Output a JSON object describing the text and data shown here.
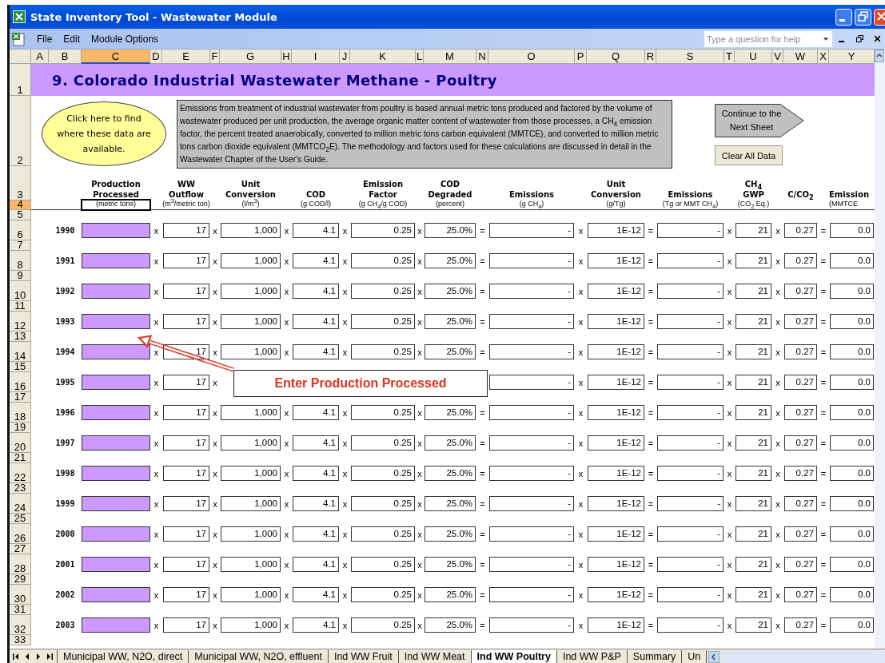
{
  "window": {
    "title": "State Inventory Tool - Wastewater Module"
  },
  "menu": [
    "File",
    "Edit",
    "Module Options"
  ],
  "help_search": {
    "placeholder": "Type a question for help"
  },
  "column_headers": [
    {
      "label": "A",
      "selected": false
    },
    {
      "label": "B",
      "selected": false
    },
    {
      "label": "C",
      "selected": true
    },
    {
      "label": "D",
      "selected": false
    },
    {
      "label": "E",
      "selected": false
    },
    {
      "label": "F",
      "selected": false
    },
    {
      "label": "G",
      "selected": false
    },
    {
      "label": "H",
      "selected": false
    },
    {
      "label": "I",
      "selected": false
    },
    {
      "label": "J",
      "selected": false
    },
    {
      "label": "K",
      "selected": false
    },
    {
      "label": "L",
      "selected": false
    },
    {
      "label": "M",
      "selected": false
    },
    {
      "label": "N",
      "selected": false
    },
    {
      "label": "O",
      "selected": false
    },
    {
      "label": "P",
      "selected": false
    },
    {
      "label": "Q",
      "selected": false
    },
    {
      "label": "R",
      "selected": false
    },
    {
      "label": "S",
      "selected": false
    },
    {
      "label": "T",
      "selected": false
    },
    {
      "label": "U",
      "selected": false
    },
    {
      "label": "V",
      "selected": false
    },
    {
      "label": "W",
      "selected": false
    },
    {
      "label": "X",
      "selected": false
    },
    {
      "label": "Y",
      "selected": false
    }
  ],
  "row_numbers": [
    {
      "label": "1",
      "selected": false
    },
    {
      "label": "2",
      "selected": false
    },
    {
      "label": "3",
      "selected": false
    },
    {
      "label": "4",
      "selected": true
    },
    {
      "label": "5",
      "selected": false
    },
    {
      "label": "6",
      "selected": false
    },
    {
      "label": "7",
      "selected": false
    },
    {
      "label": "8",
      "selected": false
    },
    {
      "label": "9",
      "selected": false
    },
    {
      "label": "10",
      "selected": false
    },
    {
      "label": "11",
      "selected": false
    },
    {
      "label": "12",
      "selected": false
    },
    {
      "label": "13",
      "selected": false
    },
    {
      "label": "14",
      "selected": false
    },
    {
      "label": "15",
      "selected": false
    },
    {
      "label": "16",
      "selected": false
    },
    {
      "label": "17",
      "selected": false
    },
    {
      "label": "18",
      "selected": false
    },
    {
      "label": "19",
      "selected": false
    },
    {
      "label": "20",
      "selected": false
    },
    {
      "label": "21",
      "selected": false
    },
    {
      "label": "22",
      "selected": false
    },
    {
      "label": "23",
      "selected": false
    },
    {
      "label": "24",
      "selected": false
    },
    {
      "label": "25",
      "selected": false
    },
    {
      "label": "26",
      "selected": false
    },
    {
      "label": "27",
      "selected": false
    },
    {
      "label": "28",
      "selected": false
    },
    {
      "label": "29",
      "selected": false
    },
    {
      "label": "30",
      "selected": false
    },
    {
      "label": "31",
      "selected": false
    },
    {
      "label": "32",
      "selected": false
    },
    {
      "label": "33",
      "selected": false
    }
  ],
  "sheet": {
    "title": "9. Colorado Industrial Wastewater Methane - Poultry",
    "info_button": "Click here to find where these data are available.",
    "description": "Emissions from treatment of industrial wastewater from poultry is based annual metric tons produced and factored by the volume of wastewater produced per unit production, the average organic matter content of wastewater from those processes, a CH$_{4}$ emission factor, the percent treated anaerobically, converted to million metric tons carbon equivalent (MMTCE), and converted to million metric tons carbon dioxide equivalent (MMTCO$_{2}$E).  The methodology and factors used for these calculations are discussed in detail in the Wastewater Chapter of the User's Guide.",
    "continue_button": "Continue to the Next Sheet",
    "clear_button": "Clear All Data",
    "entry_column": {
      "heading": "Production Processed",
      "unit": "(metric tons)"
    },
    "columns": [
      {
        "heading": "WW Outflow",
        "unit": "(m$^{3}$/metric ton)"
      },
      {
        "heading": "Unit Conversion",
        "unit": "(l/m$^{3}$)"
      },
      {
        "heading": "COD",
        "unit": "(g COD/l)"
      },
      {
        "heading": "Emission Factor",
        "unit": "(g CH$_{4}$/g COD)"
      },
      {
        "heading": "COD Degraded",
        "unit": "(percent)"
      },
      {
        "heading": "Emissions",
        "unit": "(g CH$_{4}$)"
      },
      {
        "heading": "Unit Conversion",
        "unit": "(g/Tg)"
      },
      {
        "heading": "Emissions",
        "unit": "(Tg or MMT CH$_{4}$)"
      },
      {
        "heading": "CH$_{4}$ GWP",
        "unit": "(CO$_{2}$ Eq.)"
      },
      {
        "heading": "C/CO$_{2}$"
      },
      {
        "heading": "Emission",
        "unit": "(MMTCE"
      }
    ],
    "rows": [
      {
        "year": "1990",
        "cells": [
          {
            "operator": "x",
            "value": "17"
          },
          {
            "operator": "x",
            "value": "1,000"
          },
          {
            "operator": "x",
            "value": "4.1"
          },
          {
            "operator": "x",
            "value": "0.25"
          },
          {
            "operator": "x",
            "value": "25.0%"
          },
          {
            "operator": "=",
            "value": "-"
          },
          {
            "operator": "x",
            "value": "1E-12"
          },
          {
            "operator": "=",
            "value": "-"
          },
          {
            "operator": "x",
            "value": "21"
          },
          {
            "operator": "x",
            "value": "0.27"
          },
          {
            "operator": "=",
            "value": "0.0"
          }
        ]
      },
      {
        "year": "1991",
        "cells": [
          {
            "operator": "x",
            "value": "17"
          },
          {
            "operator": "x",
            "value": "1,000"
          },
          {
            "operator": "x",
            "value": "4.1"
          },
          {
            "operator": "x",
            "value": "0.25"
          },
          {
            "operator": "x",
            "value": "25.0%"
          },
          {
            "operator": "=",
            "value": "-"
          },
          {
            "operator": "x",
            "value": "1E-12"
          },
          {
            "operator": "=",
            "value": "-"
          },
          {
            "operator": "x",
            "value": "21"
          },
          {
            "operator": "x",
            "value": "0.27"
          },
          {
            "operator": "=",
            "value": "0.0"
          }
        ]
      },
      {
        "year": "1992",
        "cells": [
          {
            "operator": "x",
            "value": "17"
          },
          {
            "operator": "x",
            "value": "1,000"
          },
          {
            "operator": "x",
            "value": "4.1"
          },
          {
            "operator": "x",
            "value": "0.25"
          },
          {
            "operator": "x",
            "value": "25.0%"
          },
          {
            "operator": "=",
            "value": "-"
          },
          {
            "operator": "x",
            "value": "1E-12"
          },
          {
            "operator": "=",
            "value": "-"
          },
          {
            "operator": "x",
            "value": "21"
          },
          {
            "operator": "x",
            "value": "0.27"
          },
          {
            "operator": "=",
            "value": "0.0"
          }
        ]
      },
      {
        "year": "1993",
        "cells": [
          {
            "operator": "x",
            "value": "17"
          },
          {
            "operator": "x",
            "value": "1,000"
          },
          {
            "operator": "x",
            "value": "4.1"
          },
          {
            "operator": "x",
            "value": "0.25"
          },
          {
            "operator": "x",
            "value": "25.0%"
          },
          {
            "operator": "=",
            "value": "-"
          },
          {
            "operator": "x",
            "value": "1E-12"
          },
          {
            "operator": "=",
            "value": "-"
          },
          {
            "operator": "x",
            "value": "21"
          },
          {
            "operator": "x",
            "value": "0.27"
          },
          {
            "operator": "=",
            "value": "0.0"
          }
        ]
      },
      {
        "year": "1994",
        "cells": [
          {
            "operator": "x",
            "value": "17"
          },
          {
            "operator": "x",
            "value": "1,000"
          },
          {
            "operator": "x",
            "value": "4.1"
          },
          {
            "operator": "x",
            "value": "0.25"
          },
          {
            "operator": "x",
            "value": "25.0%"
          },
          {
            "operator": "=",
            "value": "-"
          },
          {
            "operator": "x",
            "value": "1E-12"
          },
          {
            "operator": "=",
            "value": "-"
          },
          {
            "operator": "x",
            "value": "21"
          },
          {
            "operator": "x",
            "value": "0.27"
          },
          {
            "operator": "=",
            "value": "0.0"
          }
        ]
      },
      {
        "year": "1995",
        "cells": [
          {
            "operator": "x",
            "value": "17"
          },
          {
            "operator": "x"
          },
          {},
          {},
          {},
          {
            "value": "-"
          },
          {
            "operator": "x",
            "value": "1E-12"
          },
          {
            "operator": "=",
            "value": "-"
          },
          {
            "operator": "x",
            "value": "21"
          },
          {
            "operator": "x",
            "value": "0.27"
          },
          {
            "operator": "=",
            "value": "0.0"
          }
        ]
      },
      {
        "year": "1996",
        "cells": [
          {
            "operator": "x",
            "value": "17"
          },
          {
            "operator": "x",
            "value": "1,000"
          },
          {
            "operator": "x",
            "value": "4.1"
          },
          {
            "operator": "x",
            "value": "0.25"
          },
          {
            "operator": "x",
            "value": "25.0%"
          },
          {
            "operator": "=",
            "value": "-"
          },
          {
            "operator": "x",
            "value": "1E-12"
          },
          {
            "operator": "=",
            "value": "-"
          },
          {
            "operator": "x",
            "value": "21"
          },
          {
            "operator": "x",
            "value": "0.27"
          },
          {
            "operator": "=",
            "value": "0.0"
          }
        ]
      },
      {
        "year": "1997",
        "cells": [
          {
            "operator": "x",
            "value": "17"
          },
          {
            "operator": "x",
            "value": "1,000"
          },
          {
            "operator": "x",
            "value": "4.1"
          },
          {
            "operator": "x",
            "value": "0.25"
          },
          {
            "operator": "x",
            "value": "25.0%"
          },
          {
            "operator": "=",
            "value": "-"
          },
          {
            "operator": "x",
            "value": "1E-12"
          },
          {
            "operator": "=",
            "value": "-"
          },
          {
            "operator": "x",
            "value": "21"
          },
          {
            "operator": "x",
            "value": "0.27"
          },
          {
            "operator": "=",
            "value": "0.0"
          }
        ]
      },
      {
        "year": "1998",
        "cells": [
          {
            "operator": "x",
            "value": "17"
          },
          {
            "operator": "x",
            "value": "1,000"
          },
          {
            "operator": "x",
            "value": "4.1"
          },
          {
            "operator": "x",
            "value": "0.25"
          },
          {
            "operator": "x",
            "value": "25.0%"
          },
          {
            "operator": "=",
            "value": "-"
          },
          {
            "operator": "x",
            "value": "1E-12"
          },
          {
            "operator": "=",
            "value": "-"
          },
          {
            "operator": "x",
            "value": "21"
          },
          {
            "operator": "x",
            "value": "0.27"
          },
          {
            "operator": "=",
            "value": "0.0"
          }
        ]
      },
      {
        "year": "1999",
        "cells": [
          {
            "operator": "x",
            "value": "17"
          },
          {
            "operator": "x",
            "value": "1,000"
          },
          {
            "operator": "x",
            "value": "4.1"
          },
          {
            "operator": "x",
            "value": "0.25"
          },
          {
            "operator": "x",
            "value": "25.0%"
          },
          {
            "operator": "=",
            "value": "-"
          },
          {
            "operator": "x",
            "value": "1E-12"
          },
          {
            "operator": "=",
            "value": "-"
          },
          {
            "operator": "x",
            "value": "21"
          },
          {
            "operator": "x",
            "value": "0.27"
          },
          {
            "operator": "=",
            "value": "0.0"
          }
        ]
      },
      {
        "year": "2000",
        "cells": [
          {
            "operator": "x",
            "value": "17"
          },
          {
            "operator": "x",
            "value": "1,000"
          },
          {
            "operator": "x",
            "value": "4.1"
          },
          {
            "operator": "x",
            "value": "0.25"
          },
          {
            "operator": "x",
            "value": "25.0%"
          },
          {
            "operator": "=",
            "value": "-"
          },
          {
            "operator": "x",
            "value": "1E-12"
          },
          {
            "operator": "=",
            "value": "-"
          },
          {
            "operator": "x",
            "value": "21"
          },
          {
            "operator": "x",
            "value": "0.27"
          },
          {
            "operator": "=",
            "value": "0.0"
          }
        ]
      },
      {
        "year": "2001",
        "cells": [
          {
            "operator": "x",
            "value": "17"
          },
          {
            "operator": "x",
            "value": "1,000"
          },
          {
            "operator": "x",
            "value": "4.1"
          },
          {
            "operator": "x",
            "value": "0.25"
          },
          {
            "operator": "x",
            "value": "25.0%"
          },
          {
            "operator": "=",
            "value": "-"
          },
          {
            "operator": "x",
            "value": "1E-12"
          },
          {
            "operator": "=",
            "value": "-"
          },
          {
            "operator": "x",
            "value": "21"
          },
          {
            "operator": "x",
            "value": "0.27"
          },
          {
            "operator": "=",
            "value": "0.0"
          }
        ]
      },
      {
        "year": "2002",
        "cells": [
          {
            "operator": "x",
            "value": "17"
          },
          {
            "operator": "x",
            "value": "1,000"
          },
          {
            "operator": "x",
            "value": "4.1"
          },
          {
            "operator": "x",
            "value": "0.25"
          },
          {
            "operator": "x",
            "value": "25.0%"
          },
          {
            "operator": "=",
            "value": "-"
          },
          {
            "operator": "x",
            "value": "1E-12"
          },
          {
            "operator": "=",
            "value": "-"
          },
          {
            "operator": "x",
            "value": "21"
          },
          {
            "operator": "x",
            "value": "0.27"
          },
          {
            "operator": "=",
            "value": "0.0"
          }
        ]
      },
      {
        "year": "2003",
        "cells": [
          {
            "operator": "x",
            "value": "17"
          },
          {
            "operator": "x",
            "value": "1,000"
          },
          {
            "operator": "x",
            "value": "4.1"
          },
          {
            "operator": "x",
            "value": "0.25"
          },
          {
            "operator": "x",
            "value": "25.0%"
          },
          {
            "operator": "=",
            "value": "-"
          },
          {
            "operator": "x",
            "value": "1E-12"
          },
          {
            "operator": "=",
            "value": "-"
          },
          {
            "operator": "x",
            "value": "21"
          },
          {
            "operator": "x",
            "value": "0.27"
          },
          {
            "operator": "=",
            "value": "0.0"
          }
        ]
      }
    ]
  },
  "callout": {
    "text": "Enter Production Processed"
  },
  "sheet_tabs": [
    {
      "label": "Municipal WW, N2O, direct",
      "selected": false
    },
    {
      "label": "Municipal WW, N2O, effluent",
      "selected": false
    },
    {
      "label": "Ind WW Fruit",
      "selected": false
    },
    {
      "label": "Ind WW Meat",
      "selected": false
    },
    {
      "label": "Ind WW Poultry",
      "selected": true
    },
    {
      "label": "Ind WW P&P",
      "selected": false
    },
    {
      "label": "Summary",
      "selected": false
    },
    {
      "label": "Un",
      "selected": false
    }
  ]
}
